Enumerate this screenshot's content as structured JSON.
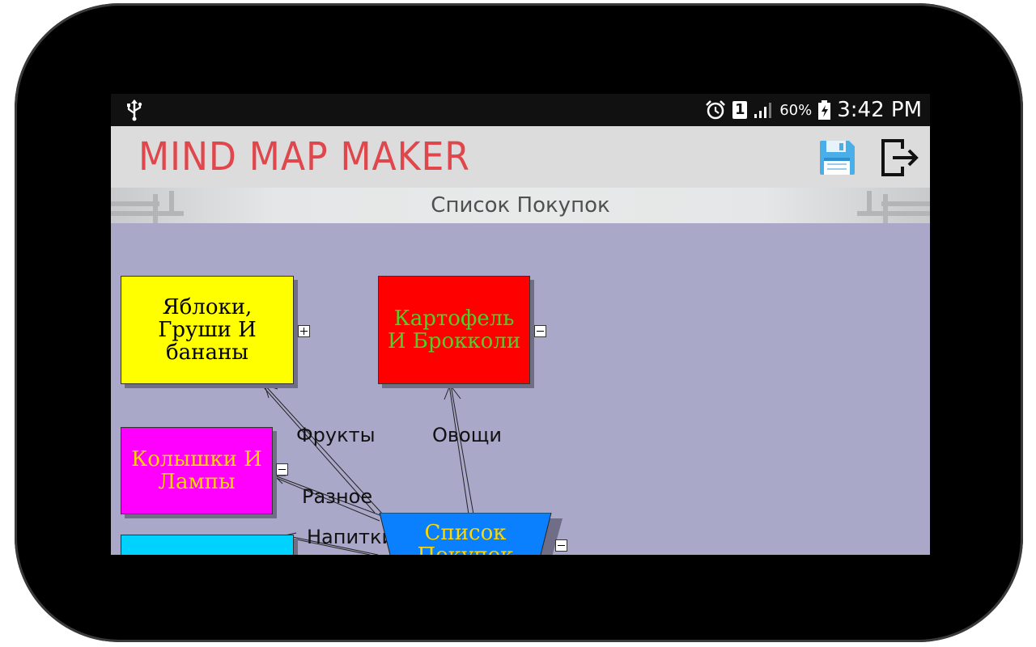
{
  "status_bar": {
    "battery_percent": "60%",
    "time": "3:42 PM",
    "sim_slot": "1",
    "icons": [
      "usb-icon",
      "alarm-icon",
      "sim-icon",
      "signal-icon",
      "battery-charging-icon"
    ]
  },
  "app": {
    "title": "MIND MAP MAKER",
    "actions": [
      "save-icon",
      "exit-icon"
    ]
  },
  "map": {
    "title": "Список Покупок"
  },
  "nodes": {
    "fruits": {
      "text": "Яблоки,\nГруши И\nбананы",
      "bg": "#ffff00",
      "color": "#000000",
      "toggle": "plus"
    },
    "vegetables": {
      "text": "Картофель\nИ Брокколи",
      "bg": "#ff0000",
      "color": "#4dd12a",
      "toggle": "minus"
    },
    "misc": {
      "text": "Колышки И\nЛампы",
      "bg": "#ff00ff",
      "color": "#ffd700",
      "toggle": "minus"
    },
    "drinks": {
      "text": "",
      "bg": "#00d2ff",
      "color": "#000000",
      "toggle": ""
    },
    "root": {
      "text": "Список\nПокупок",
      "bg": "#0a80ff",
      "color": "#ffd700",
      "toggle": "minus"
    }
  },
  "edges": {
    "fruits": "Фрукты",
    "vegetables": "Овощи",
    "misc": "Разное",
    "drinks": "Напитки"
  }
}
